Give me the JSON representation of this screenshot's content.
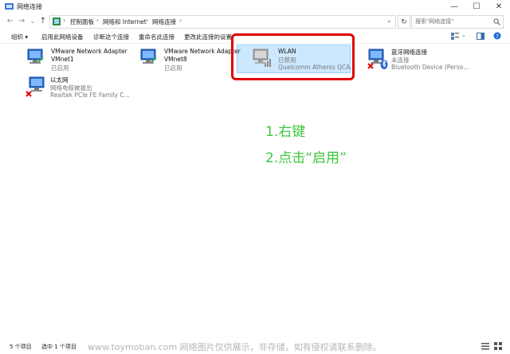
{
  "window": {
    "title": "网络连接",
    "min_glyph": "—",
    "max_glyph": "☐",
    "close_glyph": "✕"
  },
  "nav": {
    "back_glyph": "←",
    "forward_glyph": "→",
    "up_glyph": "↑",
    "dropdown_glyph": "⌄",
    "refresh_glyph": "↻"
  },
  "address": {
    "breadcrumbs": [
      "控制面板",
      "网络和 Internet",
      "网络连接"
    ],
    "separator": "›"
  },
  "search": {
    "placeholder": "搜索\"网络连接\""
  },
  "toolbar": {
    "organize": "组织 ▾",
    "enable_device": "启用此网络设备",
    "diagnose": "诊断这个连接",
    "rename": "重命名此连接",
    "change_settings": "更改此连接的设置"
  },
  "connections": [
    {
      "name": "VMware Network Adapter",
      "line2": "VMnet1",
      "line3": "已启用"
    },
    {
      "name": "VMware Network Adapter",
      "line2": "VMnet8",
      "line3": "已启用"
    },
    {
      "name": "WLAN",
      "line2": "已禁用",
      "line3": "Qualcomm Atheros QCA..."
    },
    {
      "name": "蓝牙网络连接",
      "line2": "未连接",
      "line3": "Bluetooth Device (Perso..."
    },
    {
      "name": "以太网",
      "line2": "网络电缆被拔出",
      "line3": "Realtek PCIe FE Family C..."
    }
  ],
  "annotations": {
    "step1": "1.右键",
    "step2": "2.点击“启用”"
  },
  "status": {
    "count": "5 个项目",
    "selected": "选中 1 个项目"
  },
  "watermark": "www.toymoban.com 网络图片仅供展示，非存储，如有侵权请联系删除。",
  "colors": {
    "selection_fill": "#cce8ff",
    "highlight_border": "#e00000",
    "annotation_text": "#3cc83c"
  }
}
